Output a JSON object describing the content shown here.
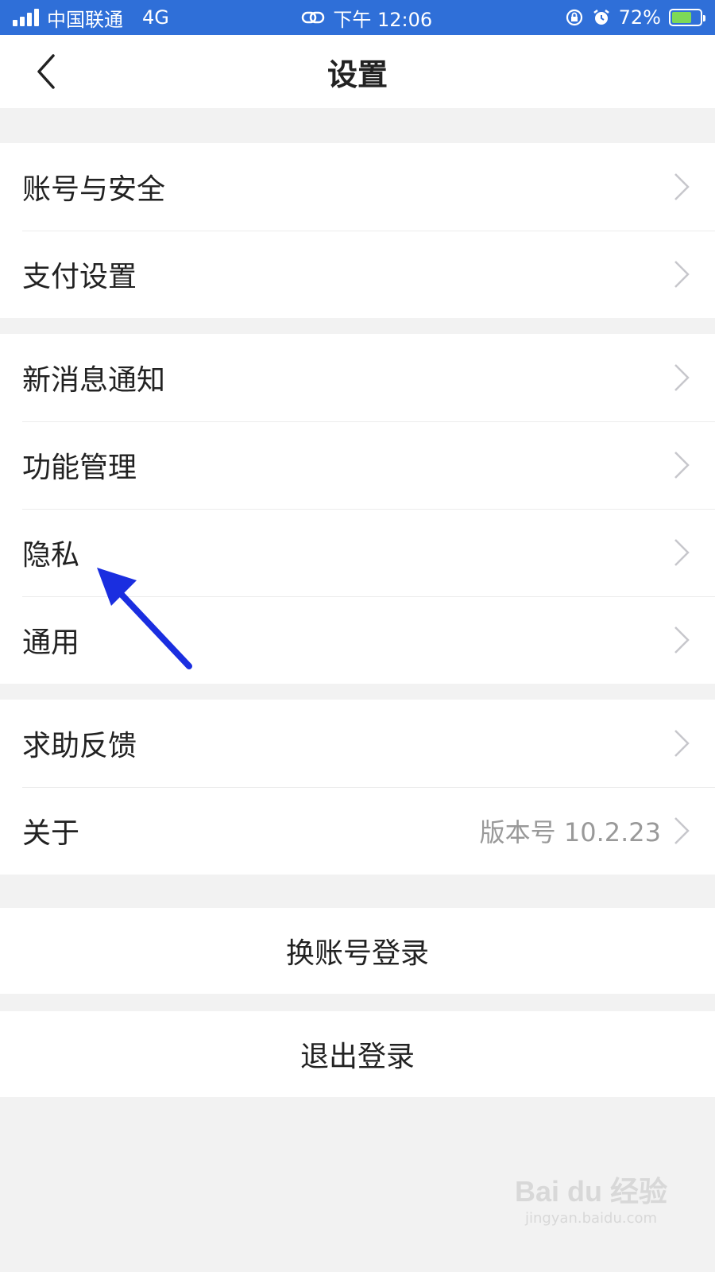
{
  "status_bar": {
    "carrier": "中国联通",
    "network": "4G",
    "time": "下午 12:06",
    "battery": "72%",
    "battery_level": 0.72
  },
  "nav": {
    "title": "设置",
    "back_icon": "chevron-left-icon"
  },
  "groups": [
    {
      "items": [
        {
          "label": "账号与安全"
        },
        {
          "label": "支付设置"
        }
      ]
    },
    {
      "items": [
        {
          "label": "新消息通知"
        },
        {
          "label": "功能管理"
        },
        {
          "label": "隐私"
        },
        {
          "label": "通用"
        }
      ]
    },
    {
      "items": [
        {
          "label": "求助反馈"
        },
        {
          "label": "关于",
          "value": "版本号 10.2.23"
        }
      ]
    }
  ],
  "buttons": {
    "switch_account": "换账号登录",
    "logout": "退出登录"
  },
  "watermark": {
    "logo": "Bai du 经验",
    "url": "jingyan.baidu.com"
  },
  "colors": {
    "status_bar": "#2f6fd8",
    "annotation_arrow": "#1a2ee0",
    "chevron": "#c7c7cc"
  }
}
